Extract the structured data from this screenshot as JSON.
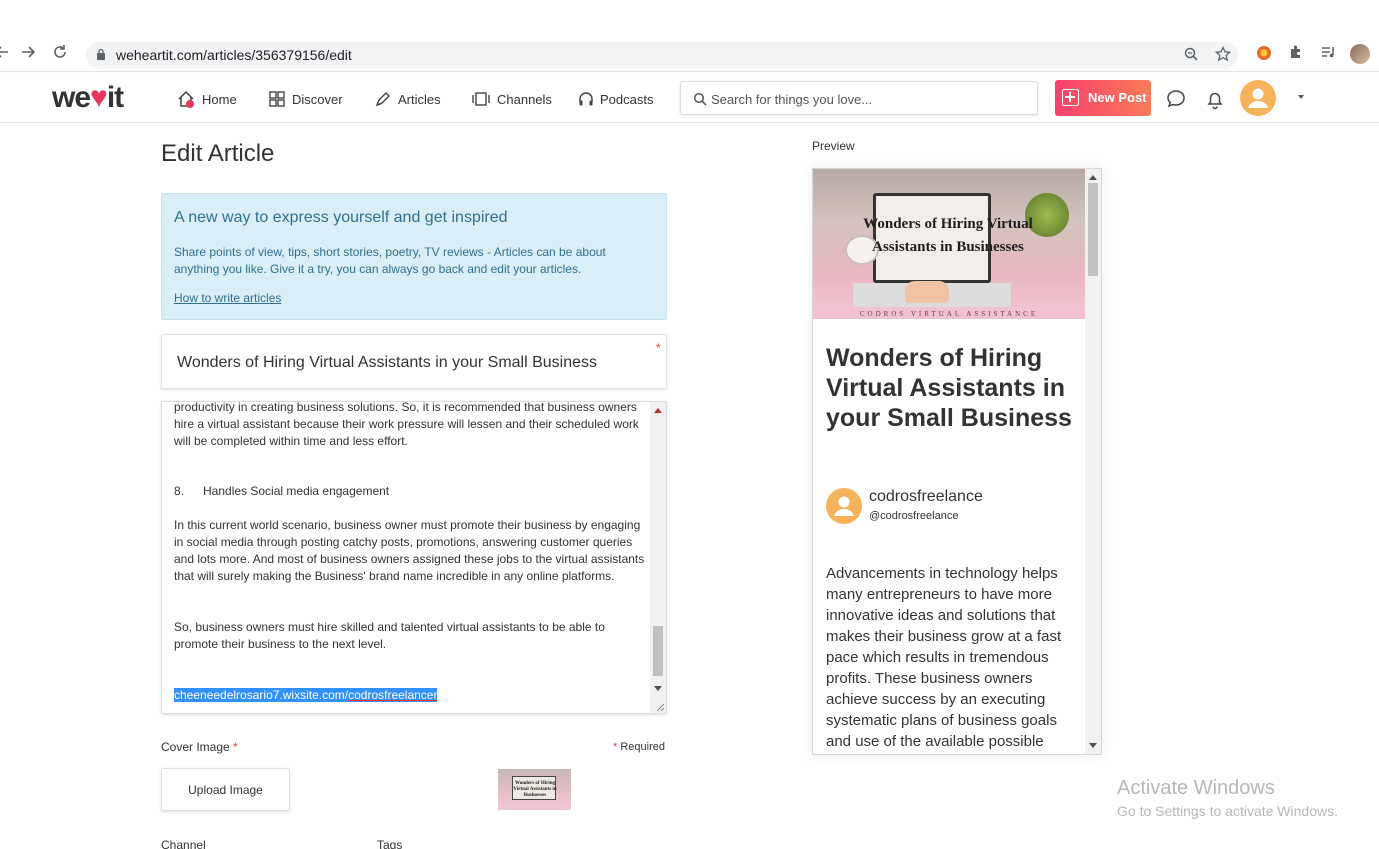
{
  "browser": {
    "url": "weheartit.com/articles/356379156/edit"
  },
  "header": {
    "logo_prefix": "we",
    "logo_suffix": "it",
    "nav": [
      {
        "label": "Home"
      },
      {
        "label": "Discover"
      },
      {
        "label": "Articles"
      },
      {
        "label": "Channels"
      },
      {
        "label": "Podcasts"
      }
    ],
    "search_placeholder": "Search for things you love...",
    "new_post_label": "New Post"
  },
  "editor": {
    "page_title": "Edit Article",
    "info_title": "A new way to express yourself and get inspired",
    "info_body": "Share points of view, tips, short stories, poetry, TV reviews - Articles can be about anything you like. Give it a try, you can always go back and edit your articles.",
    "info_link": "How to write articles",
    "title_value": "Wonders of Hiring Virtual Assistants in your Small Business",
    "required_mark": "*",
    "content": {
      "p1": "productivity in creating business solutions. So, it is recommended that business owners hire a virtual assistant because their work pressure will lessen and their scheduled work will be completed within time and less effort.",
      "heading_number": "8.",
      "heading": "Handles Social media engagement",
      "p2": "In this current world scenario, business owner must promote their business by engaging in social media through posting catchy posts, promotions, answering customer queries and lots more. And most of business owners assigned these jobs to the virtual assistants that will surely making the Business' brand name incredible in any online platforms.",
      "p3": "So, business owners must hire skilled and talented virtual assistants to be able to promote their business to the next level.",
      "link_prefix": "cheeneedelrosario7.wixsite.com/",
      "link_suffix": "codrosfreelancer"
    },
    "cover_label": "Cover Image",
    "required_note": "Required",
    "upload_label": "Upload Image",
    "channel_label": "Channel",
    "tags_label": "Tags",
    "cover_thumb_title": "Wonders of Hiring Virtual Assistants in Businesses"
  },
  "preview": {
    "label": "Preview",
    "image_title": "Wonders of Hiring Virtual Assistants in Businesses",
    "image_strip": "CODROS VIRTUAL ASSISTANCE",
    "title": "Wonders of Hiring Virtual Assistants in your Small Business",
    "author": "codrosfreelance",
    "handle": "@codrosfreelance",
    "body": "Advancements in technology helps many entrepreneurs to have more innovative ideas and solutions that makes their business grow at a fast pace which results in tremendous profits. These business owners achieve success by an executing systematic plans of business goals and use of the available possible"
  },
  "watermark": {
    "title": "Activate Windows",
    "subtitle": "Go to Settings to activate Windows."
  },
  "colors": {
    "brand_heart": "#e8375e",
    "new_post_start": "#f6416c",
    "new_post_end": "#fb7b59",
    "info_bg": "#d9eef7",
    "info_text": "#31708f",
    "avatar": "#f7b35a",
    "selection": "#3390ff"
  },
  "icons": {
    "back": "arrow-left-icon",
    "forward": "arrow-right-icon",
    "reload": "reload-icon",
    "lock": "lock-icon",
    "zoom": "zoom-icon",
    "bookmark": "star-icon",
    "extensions": "puzzle-icon",
    "media": "media-control-icon",
    "search": "search-icon",
    "messages": "chat-bubble-icon",
    "notifications": "bell-icon"
  }
}
